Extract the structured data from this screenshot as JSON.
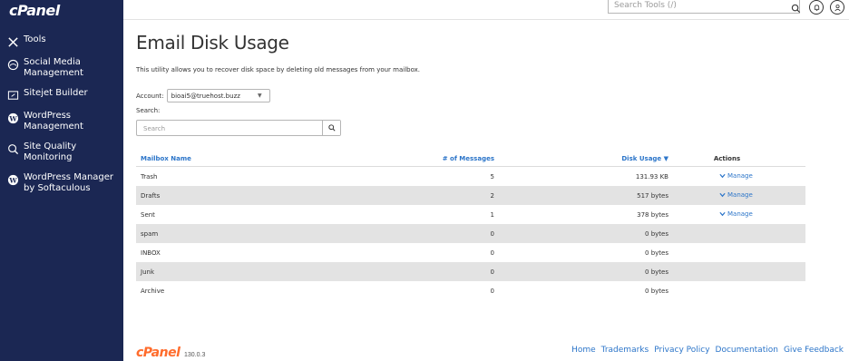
{
  "brand": {
    "logo_text": "cPanel",
    "version": "130.0.3"
  },
  "topbar": {
    "search_placeholder": "Search Tools (/)"
  },
  "sidebar": {
    "items": [
      {
        "label": "Tools",
        "icon": "tools-icon"
      },
      {
        "label": "Social Media Management",
        "icon": "social-media-icon"
      },
      {
        "label": "Sitejet Builder",
        "icon": "sitejet-icon"
      },
      {
        "label": "WordPress Management",
        "icon": "wordpress-icon"
      },
      {
        "label": "Site Quality Monitoring",
        "icon": "site-quality-icon"
      },
      {
        "label": "WordPress Manager by Softaculous",
        "icon": "wordpress-icon"
      }
    ]
  },
  "page": {
    "title": "Email Disk Usage",
    "intro": "This utility allows you to recover disk space by deleting old messages from your mailbox.",
    "account_label": "Account:",
    "account_value": "bioai5@truehost.buzz",
    "search_label": "Search:",
    "search_placeholder": "Search"
  },
  "table": {
    "headers": {
      "name": "Mailbox Name",
      "messages": "# of Messages",
      "disk": "Disk Usage ▼",
      "actions": "Actions"
    },
    "rows": [
      {
        "name": "Trash",
        "messages": "5",
        "disk": "131.93 KB",
        "action": "Manage"
      },
      {
        "name": "Drafts",
        "messages": "2",
        "disk": "517 bytes",
        "action": "Manage"
      },
      {
        "name": "Sent",
        "messages": "1",
        "disk": "378 bytes",
        "action": "Manage"
      },
      {
        "name": "spam",
        "messages": "0",
        "disk": "0 bytes",
        "action": ""
      },
      {
        "name": "INBOX",
        "messages": "0",
        "disk": "0 bytes",
        "action": ""
      },
      {
        "name": "Junk",
        "messages": "0",
        "disk": "0 bytes",
        "action": ""
      },
      {
        "name": "Archive",
        "messages": "0",
        "disk": "0 bytes",
        "action": ""
      }
    ]
  },
  "footer": {
    "links": [
      "Home",
      "Trademarks",
      "Privacy Policy",
      "Documentation",
      "Give Feedback"
    ]
  },
  "colors": {
    "sidebar_bg": "#1b2753",
    "link": "#2c75c9",
    "footer_logo": "#ff6c2c",
    "row_alt": "#e3e3e3"
  }
}
